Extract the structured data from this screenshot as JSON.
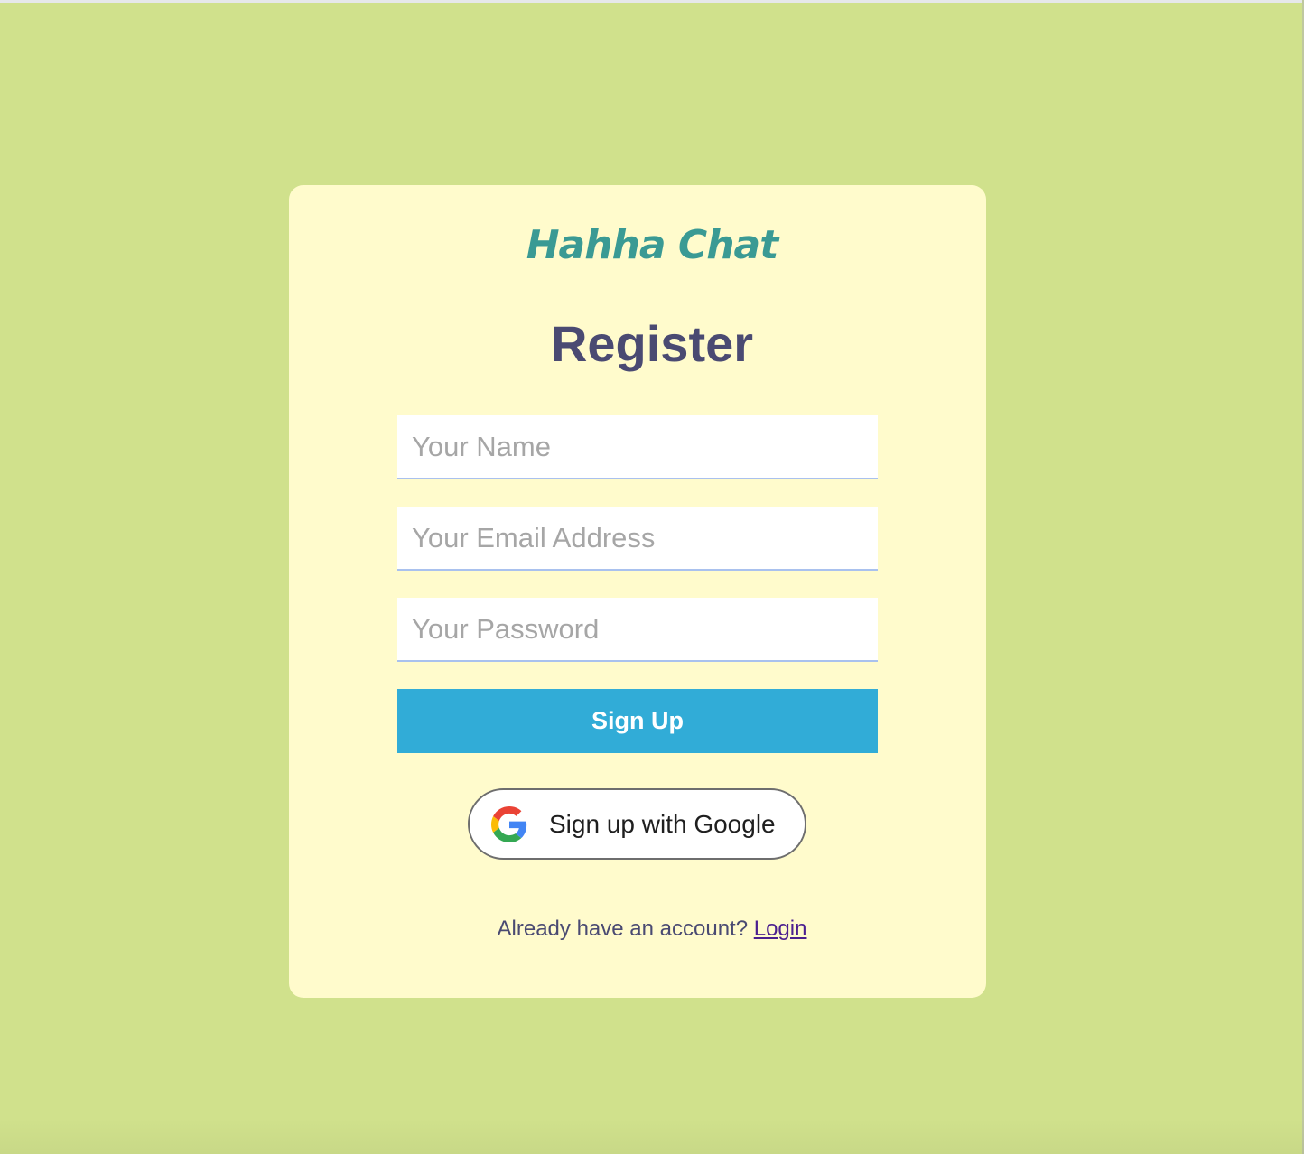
{
  "colors": {
    "page_background": "#d0e18c",
    "card_background": "#fffbcc",
    "logo": "#3a9a94",
    "title": "#4a4a72",
    "signup_button": "#31acd7",
    "input_underline": "#a9c1ee",
    "login_link": "#4b1f8f"
  },
  "brand": {
    "logo_text": "Hahha Chat"
  },
  "form": {
    "title": "Register",
    "name": {
      "placeholder": "Your Name",
      "value": ""
    },
    "email": {
      "placeholder": "Your Email Address",
      "value": ""
    },
    "password": {
      "placeholder": "Your Password",
      "value": ""
    },
    "submit_label": "Sign Up",
    "google": {
      "icon": "google-g-icon",
      "label": "Sign up with Google"
    }
  },
  "footer": {
    "prompt": "Already have an account?",
    "link_label": "Login"
  }
}
